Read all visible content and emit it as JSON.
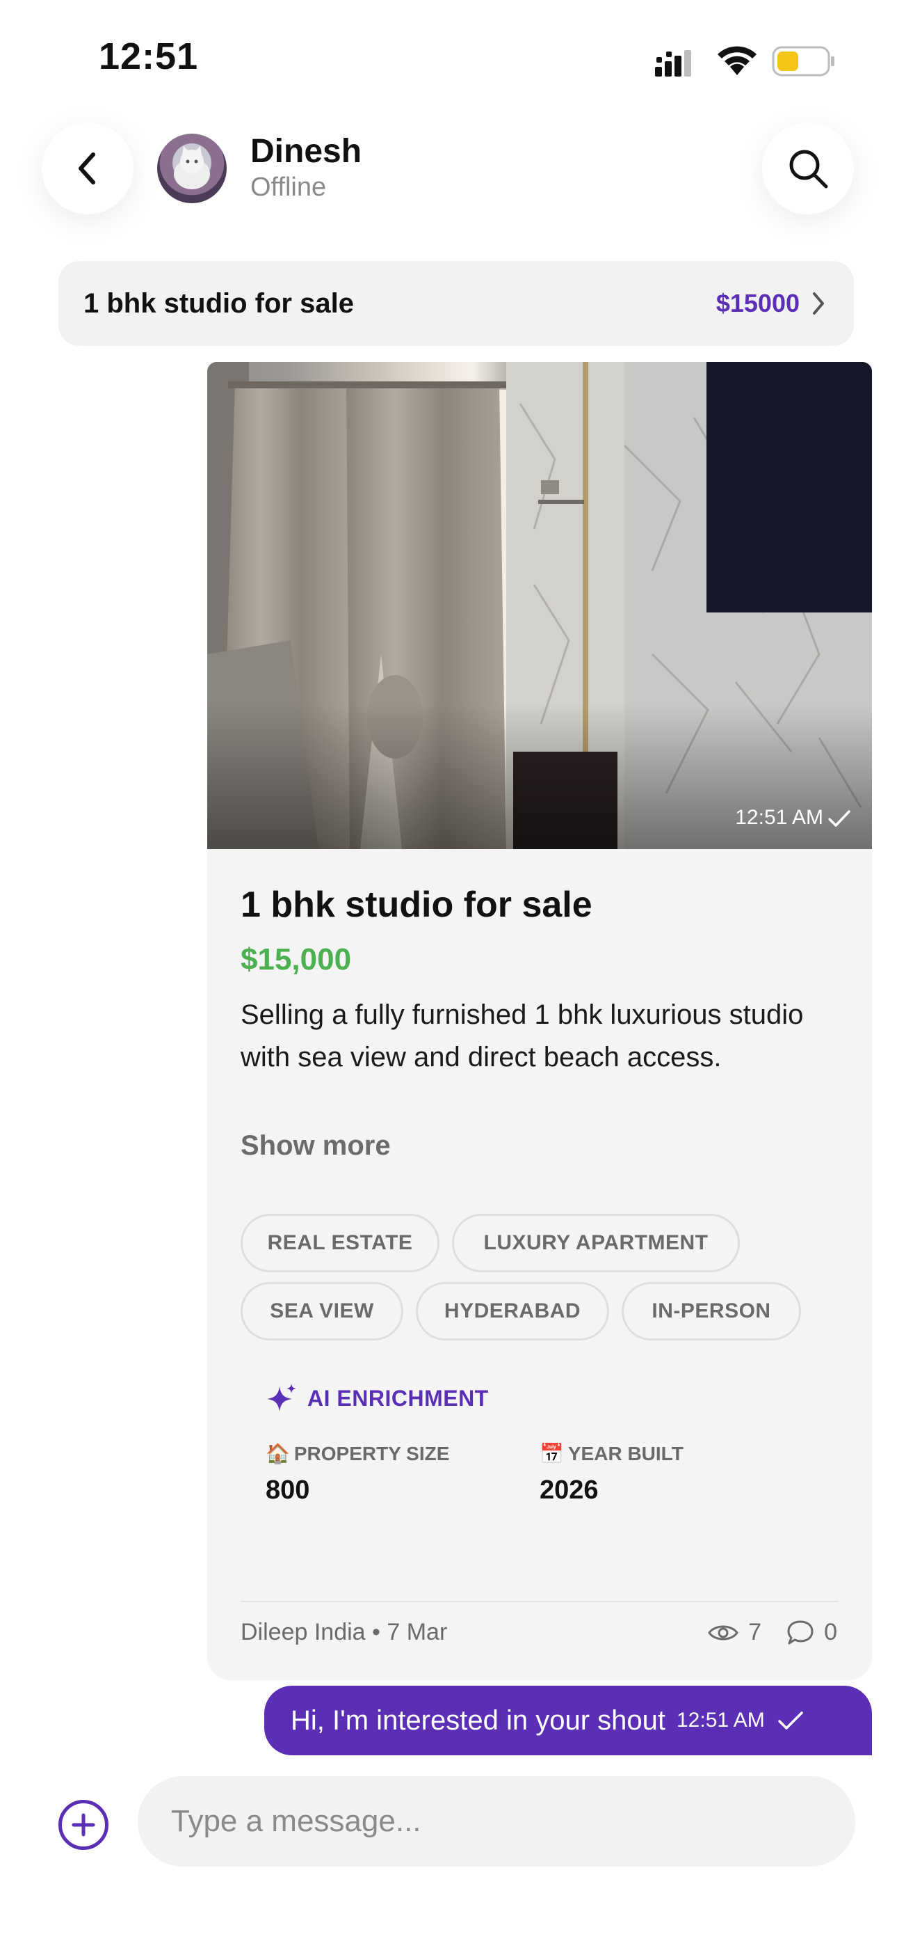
{
  "status_bar": {
    "time": "12:51"
  },
  "header": {
    "contact_name": "Dinesh",
    "contact_status": "Offline"
  },
  "listing_pill": {
    "title": "1 bhk studio for sale",
    "price": "$15000"
  },
  "card": {
    "photo_time": "12:51 AM",
    "title": "1 bhk studio for sale",
    "price": "$15,000",
    "description": "Selling a fully furnished 1 bhk luxurious studio with sea view and direct beach access.",
    "show_more": "Show more",
    "tags": [
      "REAL ESTATE",
      "LUXURY APARTMENT",
      "SEA VIEW",
      "HYDERABAD",
      "IN-PERSON"
    ],
    "ai": {
      "label": "AI ENRICHMENT",
      "stats": [
        {
          "icon": "🏠",
          "label": "PROPERTY SIZE",
          "value": "800"
        },
        {
          "icon": "📅",
          "label": "YEAR BUILT",
          "value": "2026"
        }
      ]
    },
    "meta": "Dileep India • 7 Mar",
    "views": "7",
    "comments": "0"
  },
  "outgoing": {
    "text": "Hi, I'm interested in your shout",
    "time": "12:51 AM"
  },
  "composer": {
    "placeholder": "Type a message..."
  },
  "colors": {
    "accent": "#5b2fb5",
    "price_green": "#4caf50",
    "battery_yellow": "#f5c518"
  }
}
